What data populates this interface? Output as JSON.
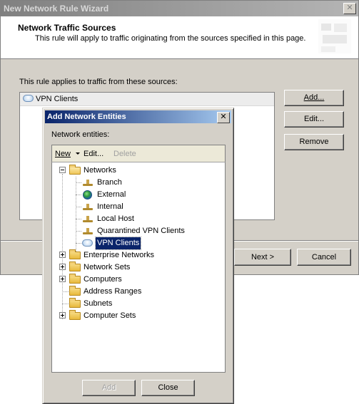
{
  "wizard": {
    "title": "New Network Rule Wizard",
    "close_glyph": "✕",
    "heading": "Network Traffic Sources",
    "subheading": "This rule will apply to traffic originating from the sources specified in this page.",
    "applies_label": "This rule applies to traffic from these sources:",
    "sources": [
      {
        "label": "VPN Clients",
        "icon": "vpn-clients-cloud-icon"
      }
    ],
    "buttons": {
      "add": "Add...",
      "edit": "Edit...",
      "remove": "Remove",
      "next": "Next >",
      "cancel": "Cancel"
    }
  },
  "dialog": {
    "title": "Add Network Entities",
    "close_glyph": "✕",
    "entities_label": "Network entities:",
    "toolbar": {
      "new": "New",
      "edit": "Edit...",
      "delete": "Delete"
    },
    "tree": {
      "networks": "Networks",
      "children": [
        {
          "label": "Branch",
          "icon": "network-icon"
        },
        {
          "label": "External",
          "icon": "globe-icon"
        },
        {
          "label": "Internal",
          "icon": "network-icon"
        },
        {
          "label": "Local Host",
          "icon": "network-icon"
        },
        {
          "label": "Quarantined VPN Clients",
          "icon": "network-icon"
        },
        {
          "label": "VPN Clients",
          "icon": "vpn-clients-cloud-icon",
          "selected": true
        }
      ],
      "folders": [
        {
          "label": "Enterprise Networks",
          "expandable": true
        },
        {
          "label": "Network Sets",
          "expandable": true
        },
        {
          "label": "Computers",
          "expandable": true
        },
        {
          "label": "Address Ranges",
          "expandable": false
        },
        {
          "label": "Subnets",
          "expandable": false
        },
        {
          "label": "Computer Sets",
          "expandable": true
        }
      ]
    },
    "buttons": {
      "add": "Add",
      "close": "Close"
    }
  },
  "colors": {
    "dialog_titlebar": "#0a246a",
    "selection": "#0a246a",
    "window_face": "#d4d0c8"
  }
}
